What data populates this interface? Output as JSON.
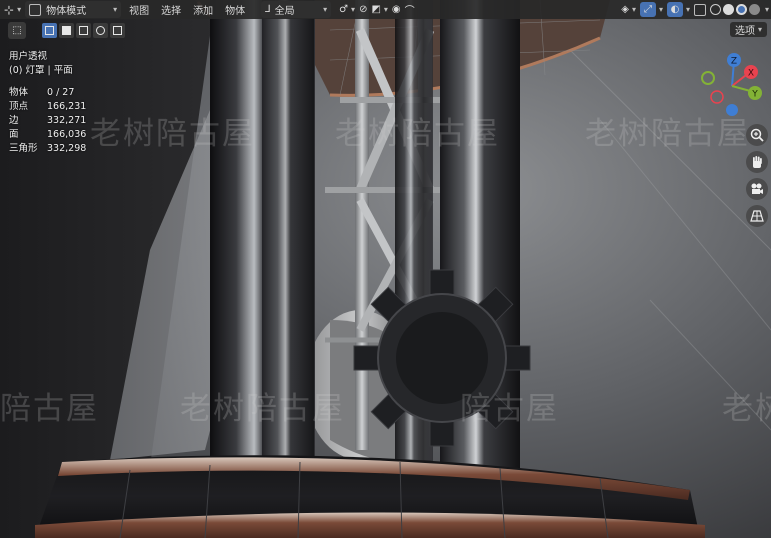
{
  "header": {
    "mode_label": "物体模式",
    "menus": [
      "视图",
      "选择",
      "添加",
      "物体"
    ],
    "transform_orientation": "全局"
  },
  "toolbar": {
    "options_label": "选项"
  },
  "viewport_info": {
    "view_name": "用户透视",
    "collection_object": "(0) 灯罩 | 平面",
    "stats": [
      {
        "label": "物体",
        "value": "0 / 27"
      },
      {
        "label": "顶点",
        "value": "166,231"
      },
      {
        "label": "边",
        "value": "332,271"
      },
      {
        "label": "面",
        "value": "166,036"
      },
      {
        "label": "三角形",
        "value": "332,298"
      }
    ]
  },
  "gizmo": {
    "x_label": "X",
    "y_label": "Y",
    "z_label": "Z",
    "x_color": "#e8434f",
    "y_color": "#83b236",
    "z_color": "#3f7ed4"
  },
  "watermark": {
    "text": "老树陪古屋",
    "fragments": [
      "老树陪古屋",
      "老树陪古屋",
      "陪古屋",
      "老树陪古屋",
      "老树陪古屋",
      "老树"
    ]
  },
  "colors": {
    "accent": "#4772b3",
    "header_bg": "#282828"
  },
  "icons": {
    "editor_type": "editor-type-icon",
    "zoom": "zoom-icon",
    "pan": "hand-icon",
    "camera": "camera-icon",
    "ortho": "grid-icon"
  }
}
